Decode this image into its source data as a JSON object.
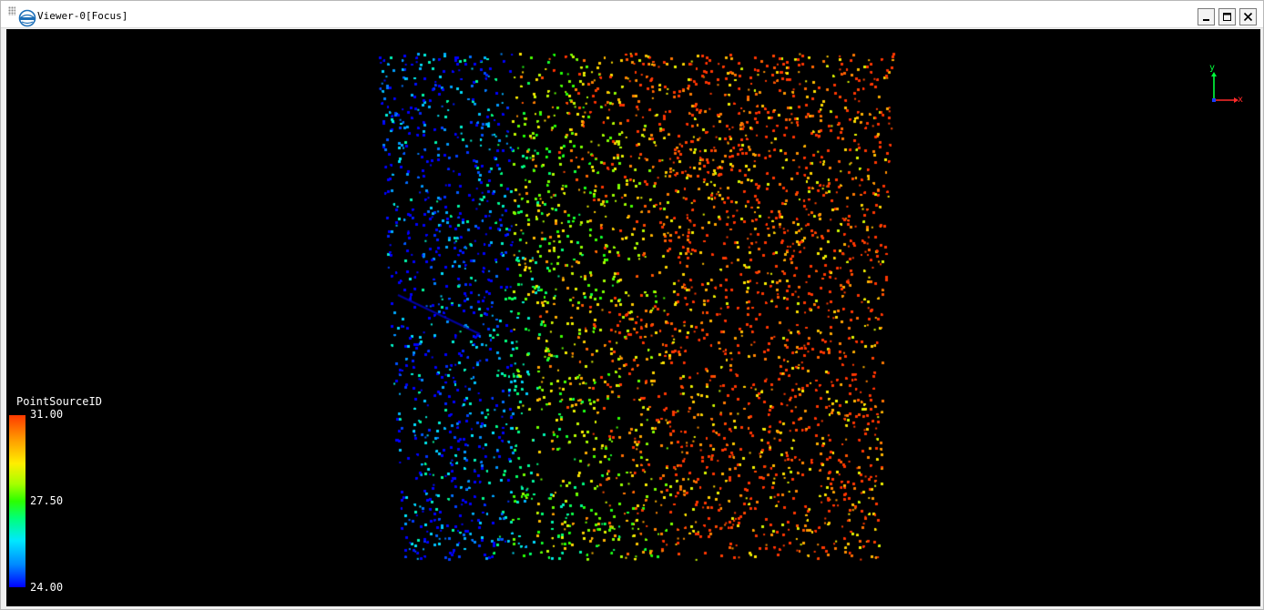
{
  "window": {
    "title": "Viewer-0[Focus]",
    "buttons": [
      "minimize",
      "maximize",
      "close"
    ]
  },
  "viewer": {
    "background": "#000000",
    "axes": {
      "y_label": "y",
      "x_label": "x"
    },
    "legend": {
      "title": "PointSourceID",
      "max_label": "31.00",
      "mid_label": "27.50",
      "min_label": "24.00",
      "colors": [
        "#ff3a00",
        "#ffee00",
        "#2bff00",
        "#00e8ff",
        "#0000ff"
      ]
    }
  }
}
